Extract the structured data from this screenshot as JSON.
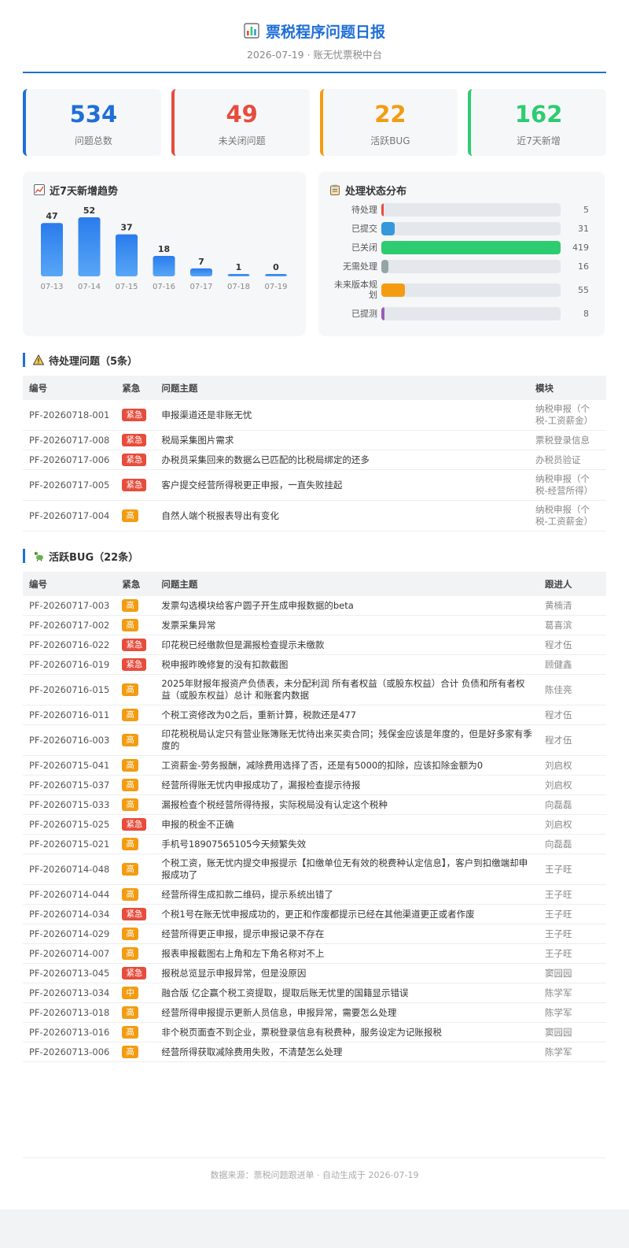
{
  "header": {
    "title": "票税程序问题日报",
    "subtitle": "2026-07-19 · 账无忧票税中台"
  },
  "kpis": [
    {
      "value": "534",
      "label": "问题总数",
      "color": "#1f6fd6"
    },
    {
      "value": "49",
      "label": "未关闭问题",
      "color": "#e74c3c"
    },
    {
      "value": "22",
      "label": "活跃BUG",
      "color": "#f39c12"
    },
    {
      "value": "162",
      "label": "近7天新增",
      "color": "#2ecc71"
    }
  ],
  "trend": {
    "title": "近7天新增趋势",
    "chart_data": {
      "type": "bar",
      "categories": [
        "07-13",
        "07-14",
        "07-15",
        "07-16",
        "07-17",
        "07-18",
        "07-19"
      ],
      "values": [
        47,
        52,
        37,
        18,
        7,
        1,
        0
      ],
      "ylim": [
        0,
        52
      ],
      "grid": false,
      "color": "#2e86f0"
    }
  },
  "status": {
    "title": "处理状态分布",
    "max": 419,
    "items": [
      {
        "label": "待处理",
        "count": 5,
        "color": "#e74c3c"
      },
      {
        "label": "已提交",
        "count": 31,
        "color": "#3498db"
      },
      {
        "label": "已关闭",
        "count": 419,
        "color": "#2ecc71"
      },
      {
        "label": "无需处理",
        "count": 16,
        "color": "#95a5a6"
      },
      {
        "label": "未来版本规划",
        "count": 55,
        "color": "#f39c12"
      },
      {
        "label": "已提测",
        "count": 8,
        "color": "#9b59b6"
      }
    ]
  },
  "pending": {
    "title": "待处理问题（5条）",
    "columns": [
      "编号",
      "紧急",
      "问题主题",
      "模块"
    ],
    "rows": [
      {
        "id": "PF-20260718-001",
        "level": "紧急",
        "subject": "申报渠道还是非账无忧",
        "module": "纳税申报（个税-工资薪金）"
      },
      {
        "id": "PF-20260717-008",
        "level": "紧急",
        "subject": "税局采集图片需求",
        "module": "票税登录信息"
      },
      {
        "id": "PF-20260717-006",
        "level": "紧急",
        "subject": "办税员采集回来的数据么已匹配的比税局绑定的还多",
        "module": "办税员验证"
      },
      {
        "id": "PF-20260717-005",
        "level": "紧急",
        "subject": "客户提交经营所得税更正申报，一直失败挂起",
        "module": "纳税申报（个税-经营所得）"
      },
      {
        "id": "PF-20260717-004",
        "level": "高",
        "subject": "自然人端个税报表导出有变化",
        "module": "纳税申报（个税-工资薪金）"
      }
    ]
  },
  "bugs": {
    "title": "活跃BUG（22条）",
    "columns": [
      "编号",
      "紧急",
      "问题主题",
      "跟进人"
    ],
    "rows": [
      {
        "id": "PF-20260717-003",
        "level": "高",
        "subject": "发票勾选模块给客户圆子开生成申报数据的beta",
        "owner": "黄楠清"
      },
      {
        "id": "PF-20260717-002",
        "level": "高",
        "subject": "发票采集异常",
        "owner": "葛喜滨"
      },
      {
        "id": "PF-20260716-022",
        "level": "紧急",
        "subject": "印花税已经缴款但是漏报检查提示未缴款",
        "owner": "程才伍"
      },
      {
        "id": "PF-20260716-019",
        "level": "紧急",
        "subject": "税申报昨晚修复的没有扣款截图",
        "owner": "顾健鑫"
      },
      {
        "id": "PF-20260716-015",
        "level": "高",
        "subject": "2025年财报年报资产负债表，未分配利润 所有者权益（或股东权益）合计 负债和所有者权益（或股东权益）总计 和账套内数据",
        "owner": "陈佳亮"
      },
      {
        "id": "PF-20260716-011",
        "level": "高",
        "subject": "个税工资修改为0之后，重新计算，税款还是477",
        "owner": "程才伍"
      },
      {
        "id": "PF-20260716-003",
        "level": "高",
        "subject": "印花税税局认定只有营业账簿账无忧待出来买卖合同；残保金应该是年度的，但是好多家有季度的",
        "owner": "程才伍"
      },
      {
        "id": "PF-20260715-041",
        "level": "高",
        "subject": "工资薪金-劳务报酬，减除费用选择了否，还是有5000的扣除，应该扣除金额为0",
        "owner": "刘启权"
      },
      {
        "id": "PF-20260715-037",
        "level": "高",
        "subject": "经营所得账无忧内申报成功了，漏报检查提示待报",
        "owner": "刘启权"
      },
      {
        "id": "PF-20260715-033",
        "level": "高",
        "subject": "漏报检查个税经营所得待报，实际税局没有认定这个税种",
        "owner": "向磊磊"
      },
      {
        "id": "PF-20260715-025",
        "level": "紧急",
        "subject": "申报的税金不正确",
        "owner": "刘启权"
      },
      {
        "id": "PF-20260715-021",
        "level": "高",
        "subject": "手机号18907565105今天频繁失效",
        "owner": "向磊磊"
      },
      {
        "id": "PF-20260714-048",
        "level": "高",
        "subject": "个税工资，账无忧内提交申报提示【扣缴单位无有效的税费种认定信息】，客户到扣缴端却申报成功了",
        "owner": "王子旺"
      },
      {
        "id": "PF-20260714-044",
        "level": "高",
        "subject": "经营所得生成扣款二维码，提示系统出错了",
        "owner": "王子旺"
      },
      {
        "id": "PF-20260714-034",
        "level": "紧急",
        "subject": "个税1号在账无忧申报成功的，更正和作废都提示已经在其他渠道更正或者作废",
        "owner": "王子旺"
      },
      {
        "id": "PF-20260714-029",
        "level": "高",
        "subject": "经营所得更正申报，提示申报记录不存在",
        "owner": "王子旺"
      },
      {
        "id": "PF-20260714-007",
        "level": "高",
        "subject": "报表申报截图右上角和左下角名称对不上",
        "owner": "王子旺"
      },
      {
        "id": "PF-20260713-045",
        "level": "紧急",
        "subject": "报税总览显示申报异常，但是没原因",
        "owner": "窦园园"
      },
      {
        "id": "PF-20260713-034",
        "level": "中",
        "subject": "融合版 亿企赢个税工资提取，提取后账无忧里的国籍显示错误",
        "owner": "陈学军"
      },
      {
        "id": "PF-20260713-018",
        "level": "高",
        "subject": "经营所得申报提示更新人员信息，申报异常，需要怎么处理",
        "owner": "陈学军"
      },
      {
        "id": "PF-20260713-016",
        "level": "高",
        "subject": "非个税页面查不到企业，票税登录信息有税费种，服务设定为记账报税",
        "owner": "窦园园"
      },
      {
        "id": "PF-20260713-006",
        "level": "高",
        "subject": "经营所得获取减除费用失败，不清楚怎么处理",
        "owner": "陈学军"
      }
    ]
  },
  "footer": {
    "text": "数据来源：票税问题跟进单 · 自动生成于 2026-07-19"
  }
}
